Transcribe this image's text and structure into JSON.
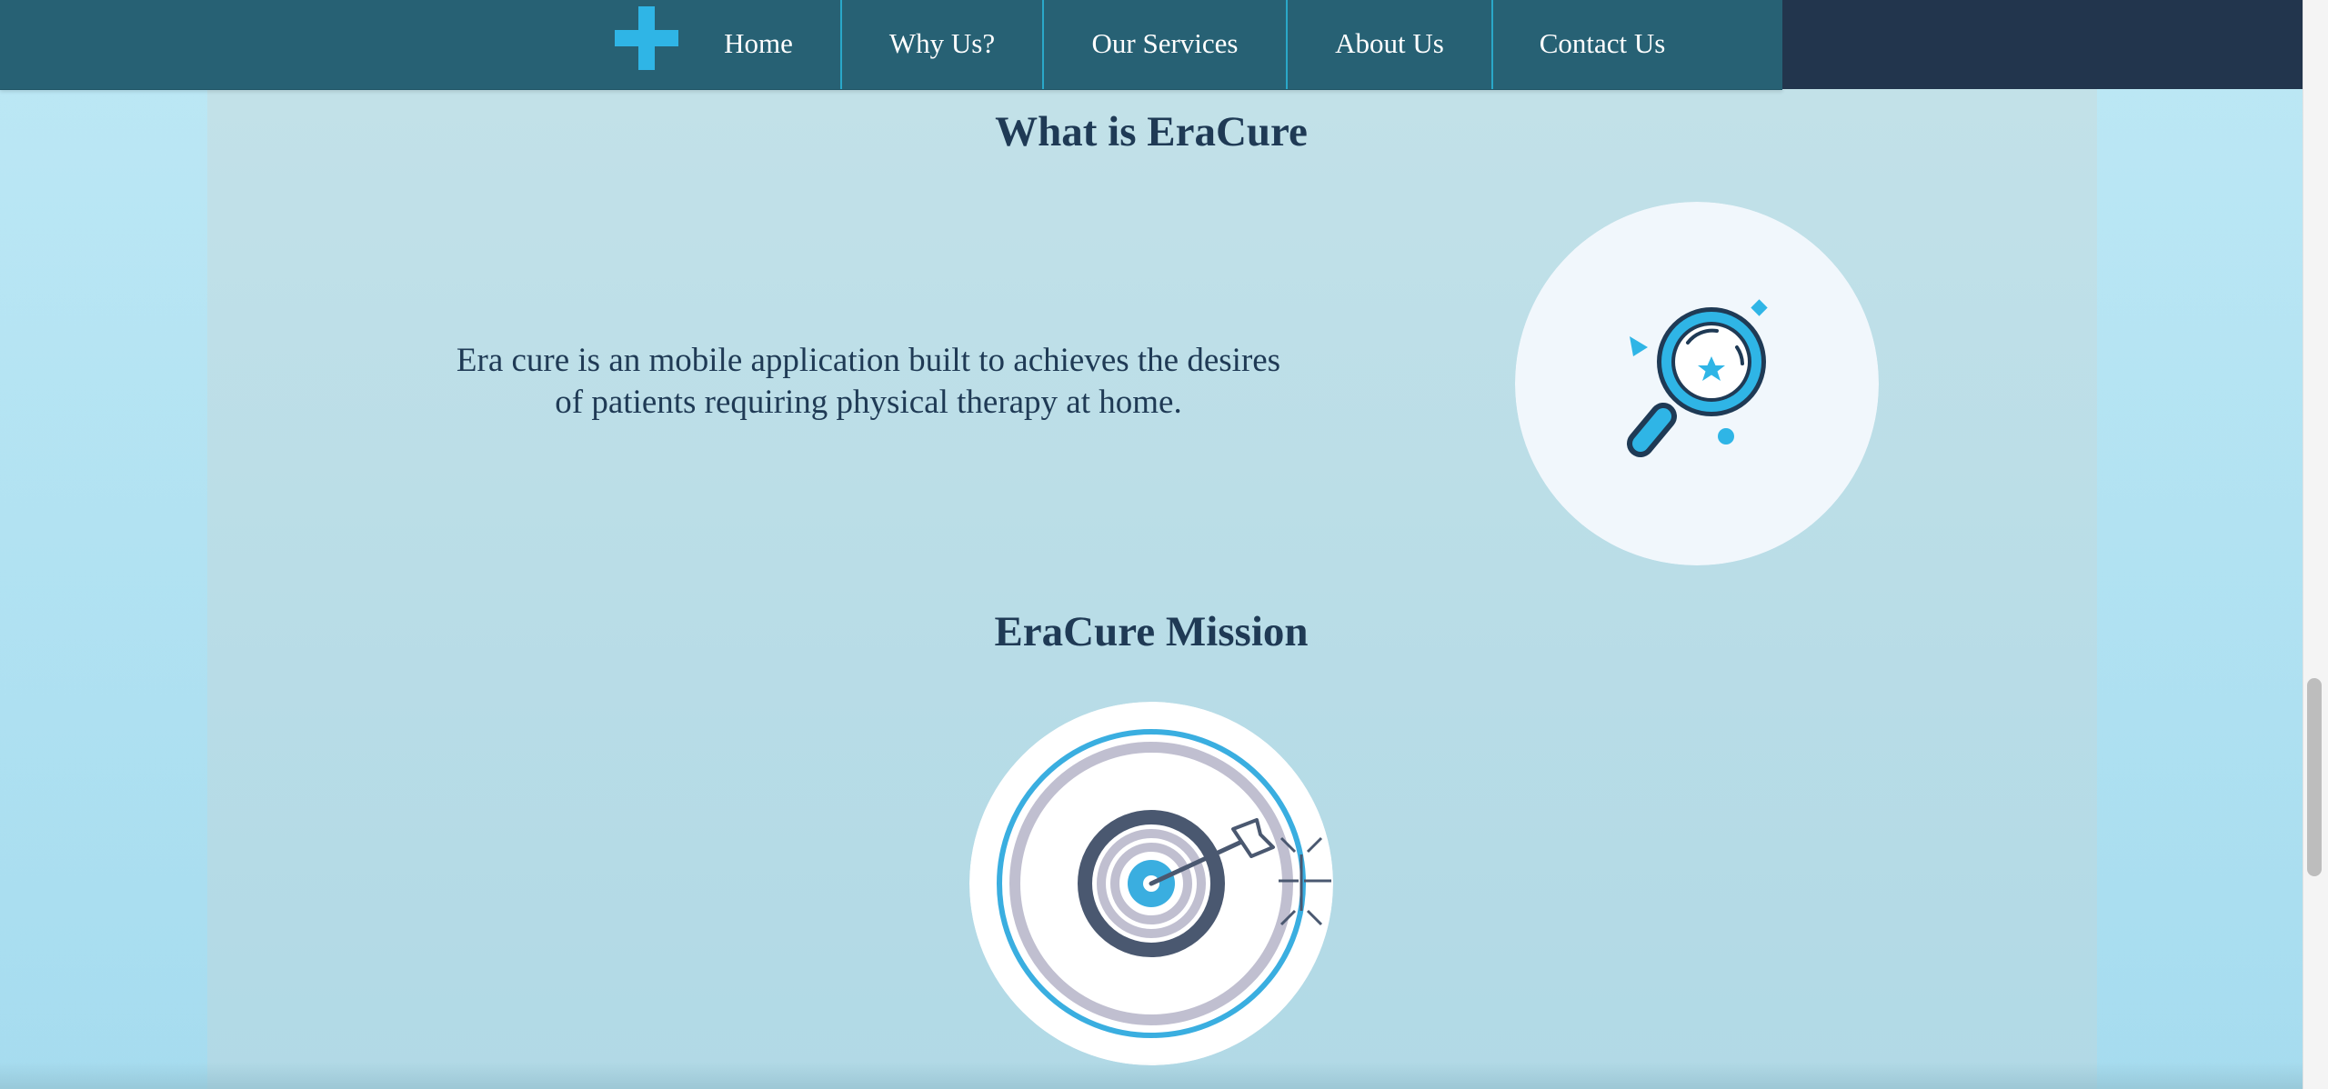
{
  "nav": {
    "logo_icon": "plus-icon",
    "items": [
      {
        "label": "Home"
      },
      {
        "label": "Why Us?"
      },
      {
        "label": "Our Services"
      },
      {
        "label": "About Us"
      },
      {
        "label": "Contact Us"
      }
    ]
  },
  "sections": [
    {
      "title": "What is EraCure",
      "text_line_1": "Era cure is an mobile application built to achieves the desires",
      "text_line_2": "of patients requiring physical therapy at home.",
      "illustration": "magnifying-glass-icon"
    },
    {
      "title": "EraCure Mission",
      "illustration": "target-arrow-icon"
    }
  ],
  "colors": {
    "nav_background": "#276174",
    "nav_right_background": "#22354d",
    "accent": "#2fb5e6",
    "heading_text": "#1f3a55",
    "page_background": "#bde8f5",
    "panel_background": "#c2e1e8"
  }
}
